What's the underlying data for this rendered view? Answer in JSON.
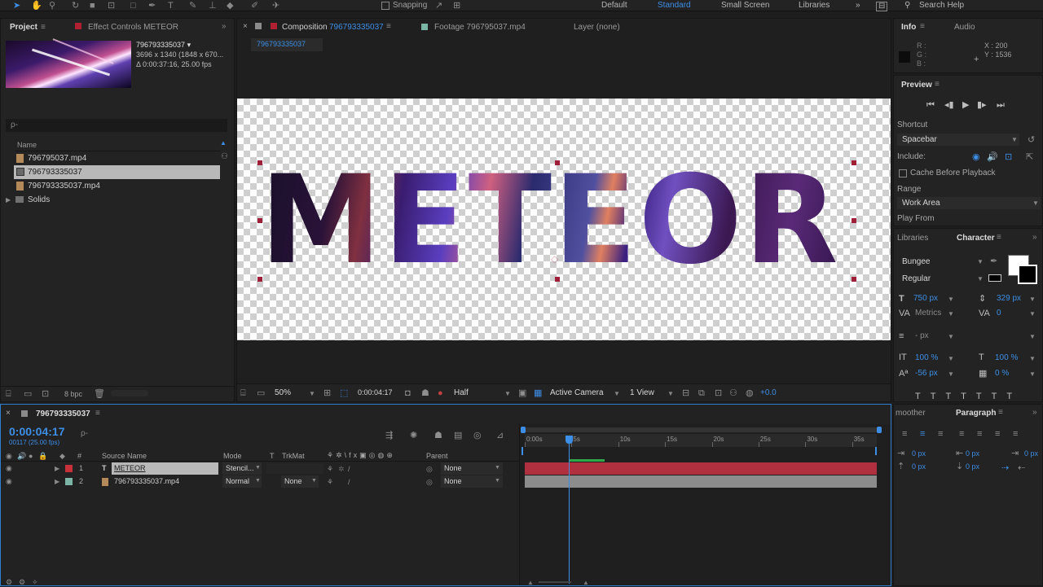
{
  "toolbar": {
    "snapping_label": "Snapping",
    "workspaces": [
      "Default",
      "Standard",
      "Small Screen",
      "Libraries"
    ],
    "active_workspace": "Standard",
    "search_help": "Search Help"
  },
  "project_panel": {
    "tab_project": "Project",
    "tab_effect_controls": "Effect Controls METEOR",
    "thumb_name": "796793335037 ▾",
    "thumb_size": "3696 x 1340  (1848 x 670...",
    "thumb_duration": "Δ 0:00:37:16, 25.00 fps",
    "search_placeholder": "ρ-",
    "column_name": "Name",
    "items": [
      {
        "name": "796795037.mp4",
        "icon": "footage-icon"
      },
      {
        "name": "796793335037",
        "icon": "composition-icon"
      },
      {
        "name": "796793335037.mp4",
        "icon": "footage-icon"
      },
      {
        "name": "Solids",
        "icon": "folder-icon"
      }
    ],
    "bpc": "8 bpc"
  },
  "viewer": {
    "tab_composition": "Composition",
    "tab_composition_name": "796793335037",
    "tab_footage": "Footage 796795037.mp4",
    "tab_layer": "Layer (none)",
    "comp_breadcrumb": "796793335037",
    "text_overlay": "METEOR",
    "zoom": "50%",
    "timecode": "0:00:04:17",
    "resolution": "Half",
    "camera": "Active Camera",
    "views": "1 View",
    "exposure": "+0.0"
  },
  "info_panel": {
    "tab_info": "Info",
    "tab_audio": "Audio",
    "r": "R :",
    "g": "G :",
    "b": "B :",
    "x": "X : 200",
    "y": "Y : 1536"
  },
  "preview_panel": {
    "title": "Preview",
    "shortcut_label": "Shortcut",
    "shortcut_value": "Spacebar",
    "include_label": "Include:",
    "cache_label": "Cache Before Playback",
    "range_label": "Range",
    "range_value": "Work Area",
    "play_from": "Play From"
  },
  "character_panel": {
    "tab_libraries": "Libraries",
    "tab_character": "Character",
    "font": "Bungee",
    "style": "Regular",
    "size": "750 px",
    "leading": "329 px",
    "kerning": "Metrics",
    "tracking": "0",
    "stroke": "- px",
    "vscale": "100 %",
    "hscale": "100 %",
    "baseline": "-56 px",
    "tsume": "0 %"
  },
  "paragraph_panel": {
    "tab_smoother": "moother",
    "tab_paragraph": "Paragraph",
    "indent_left": "0 px",
    "indent_right": "0 px",
    "space_before": "0 px",
    "space_after": "0 px"
  },
  "timeline": {
    "comp_name": "796793335037",
    "timecode": "0:00:04:17",
    "frame_info": "00117 (25.00 fps)",
    "col_source": "Source Name",
    "col_mode": "Mode",
    "col_t": "T",
    "col_trkmat": "TrkMat",
    "col_parent": "Parent",
    "layers": [
      {
        "num": "1",
        "type": "T",
        "name": "METEOR",
        "mode": "Stencil...",
        "trkmat": "",
        "parent": "None",
        "color": "#c8303a"
      },
      {
        "num": "2",
        "type": "footage",
        "name": "796793335037.mp4",
        "mode": "Normal",
        "trkmat": "None",
        "parent": "None",
        "color": "#7ab5a6"
      }
    ],
    "ruler": [
      "0:00s",
      "5s",
      "10s",
      "15s",
      "20s",
      "25s",
      "30s",
      "35s"
    ],
    "playhead_seconds": 4.68,
    "duration_seconds": 37.64
  }
}
